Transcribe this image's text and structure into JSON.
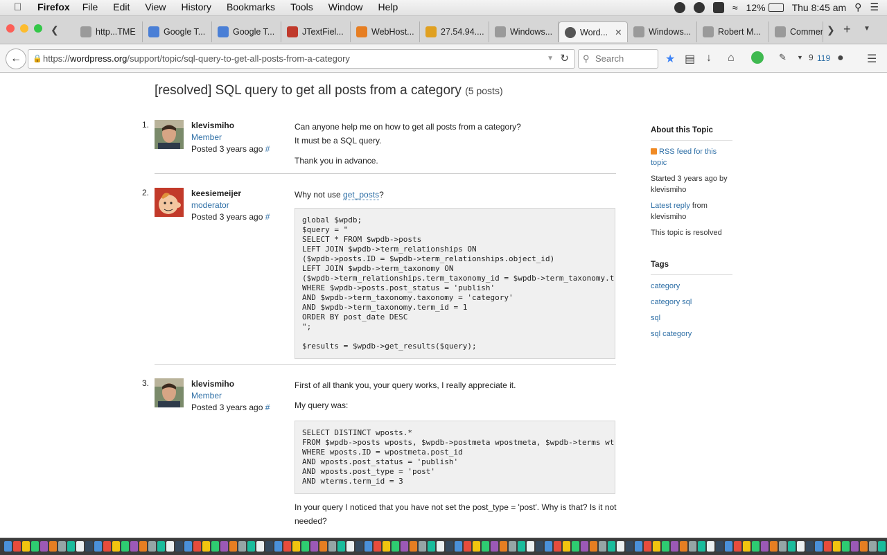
{
  "menubar": {
    "apple": "",
    "app": "Firefox",
    "items": [
      "File",
      "Edit",
      "View",
      "History",
      "Bookmarks",
      "Tools",
      "Window",
      "Help"
    ],
    "battery": "12%",
    "clock": "Thu 8:45 am"
  },
  "tabs": [
    {
      "label": "http...TME",
      "color": "#9a9a9a"
    },
    {
      "label": "Google T...",
      "color": "#4a7fd6"
    },
    {
      "label": "Google T...",
      "color": "#4a7fd6"
    },
    {
      "label": "JTextFiel...",
      "color": "#c0392b"
    },
    {
      "label": "WebHost...",
      "color": "#e67e22"
    },
    {
      "label": "27.54.94....",
      "color": "#e0a020"
    },
    {
      "label": "Windows...",
      "color": "#9a9a9a"
    },
    {
      "label": "Word...",
      "color": "#555555"
    },
    {
      "label": "Windows...",
      "color": "#9a9a9a"
    },
    {
      "label": "Robert M...",
      "color": "#9a9a9a"
    },
    {
      "label": "Commen...",
      "color": "#9a9a9a"
    }
  ],
  "nav": {
    "url_prefix": "https://",
    "url_host": "wordpress.org",
    "url_path": "/support/topic/sql-query-to-get-all-posts-from-a-category",
    "search_placeholder": "Search",
    "badge_count1": "9",
    "badge_count2": "119"
  },
  "topic": {
    "title": "[resolved] SQL query to get all posts from a category",
    "count": "(5 posts)"
  },
  "posts": [
    {
      "num": "1.",
      "author": "klevismiho",
      "role": "Member",
      "posted": "Posted 3 years ago",
      "hash": "#",
      "lines": [
        "Can anyone help me on how to get all posts from a category?",
        "It must be a SQL query.",
        "Thank you in advance."
      ]
    },
    {
      "num": "2.",
      "author": "keesiemeijer",
      "role": "moderator",
      "posted": "Posted 3 years ago",
      "hash": "#",
      "intro_before": "Why not use ",
      "intro_link": "get_posts",
      "intro_after": "?",
      "code": "global $wpdb;\n$query = \"\nSELECT * FROM $wpdb->posts\nLEFT JOIN $wpdb->term_relationships ON\n($wpdb->posts.ID = $wpdb->term_relationships.object_id)\nLEFT JOIN $wpdb->term_taxonomy ON\n($wpdb->term_relationships.term_taxonomy_id = $wpdb->term_taxonomy.term_taxonomy_id)\nWHERE $wpdb->posts.post_status = 'publish'\nAND $wpdb->term_taxonomy.taxonomy = 'category'\nAND $wpdb->term_taxonomy.term_id = 1\nORDER BY post_date DESC\n\";\n\n$results = $wpdb->get_results($query);"
    },
    {
      "num": "3.",
      "author": "klevismiho",
      "role": "Member",
      "posted": "Posted 3 years ago",
      "hash": "#",
      "line1": "First of all thank you, your query works, I really appreciate it.",
      "line2": "My query was:",
      "code": "SELECT DISTINCT wposts.*\nFROM $wpdb->posts wposts, $wpdb->postmeta wpostmeta, $wpdb->terms wterms\nWHERE wposts.ID = wpostmeta.post_id\nAND wposts.post_status = 'publish'\nAND wposts.post_type = 'post'\nAND wterms.term_id = 3",
      "line3": "In your query I noticed that you have not set the post_type = 'post'. Why is that? Is it not needed?"
    }
  ],
  "sidebar": {
    "about_heading": "About this Topic",
    "rss": "RSS feed for this topic",
    "started": "Started 3 years ago by klevismiho",
    "latest_link": "Latest reply",
    "latest_rest": " from klevismiho",
    "resolved": "This topic is resolved",
    "tags_heading": "Tags",
    "tags": [
      "category",
      "category sql",
      "sql",
      "sql category"
    ]
  }
}
